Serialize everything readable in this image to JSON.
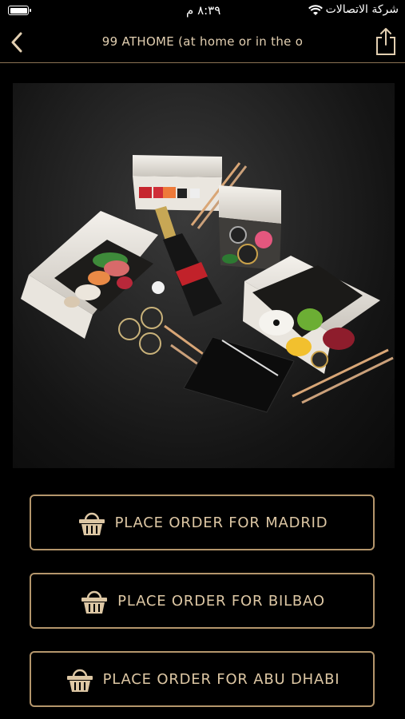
{
  "status_bar": {
    "time": "٨:٣٩ م",
    "carrier": "شركة الاتصالات"
  },
  "nav": {
    "title": "99 ATHOME (at home or in the o",
    "back_icon": "chevron-left-icon",
    "share_icon": "share-icon"
  },
  "hero": {
    "description_icon": "food-photo"
  },
  "orders": [
    {
      "label": "PLACE ORDER FOR MADRID",
      "icon": "basket-icon"
    },
    {
      "label": "PLACE ORDER FOR BILBAO",
      "icon": "basket-icon"
    },
    {
      "label": "PLACE ORDER FOR ABU DHABI",
      "icon": "basket-icon"
    }
  ],
  "colors": {
    "accent": "#b4966c",
    "text_gold": "#ddc7a4",
    "background": "#000000"
  }
}
